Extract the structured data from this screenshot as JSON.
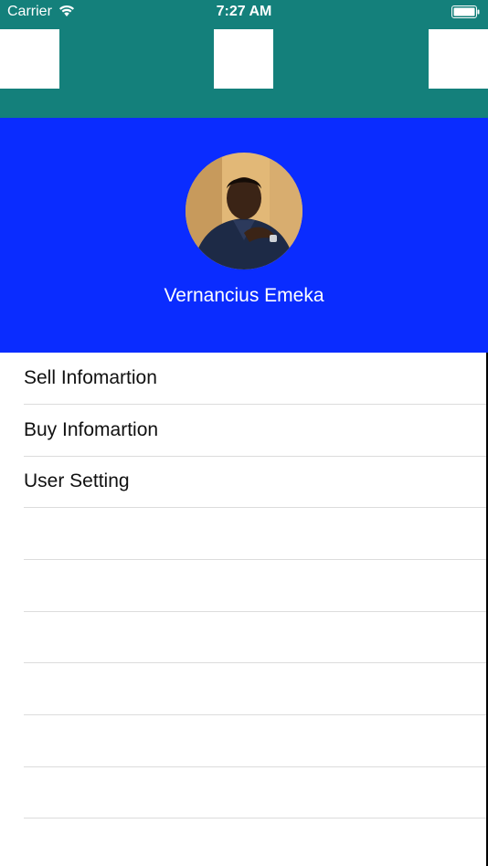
{
  "status_bar": {
    "carrier": "Carrier",
    "time": "7:27 AM"
  },
  "colors": {
    "topbar": "#14807b",
    "profile_bg": "#0a2cff"
  },
  "profile": {
    "name": "Vernancius Emeka"
  },
  "menu": {
    "items": [
      {
        "label": "Sell Infomartion"
      },
      {
        "label": "Buy Infomartion"
      },
      {
        "label": "User Setting"
      }
    ]
  }
}
